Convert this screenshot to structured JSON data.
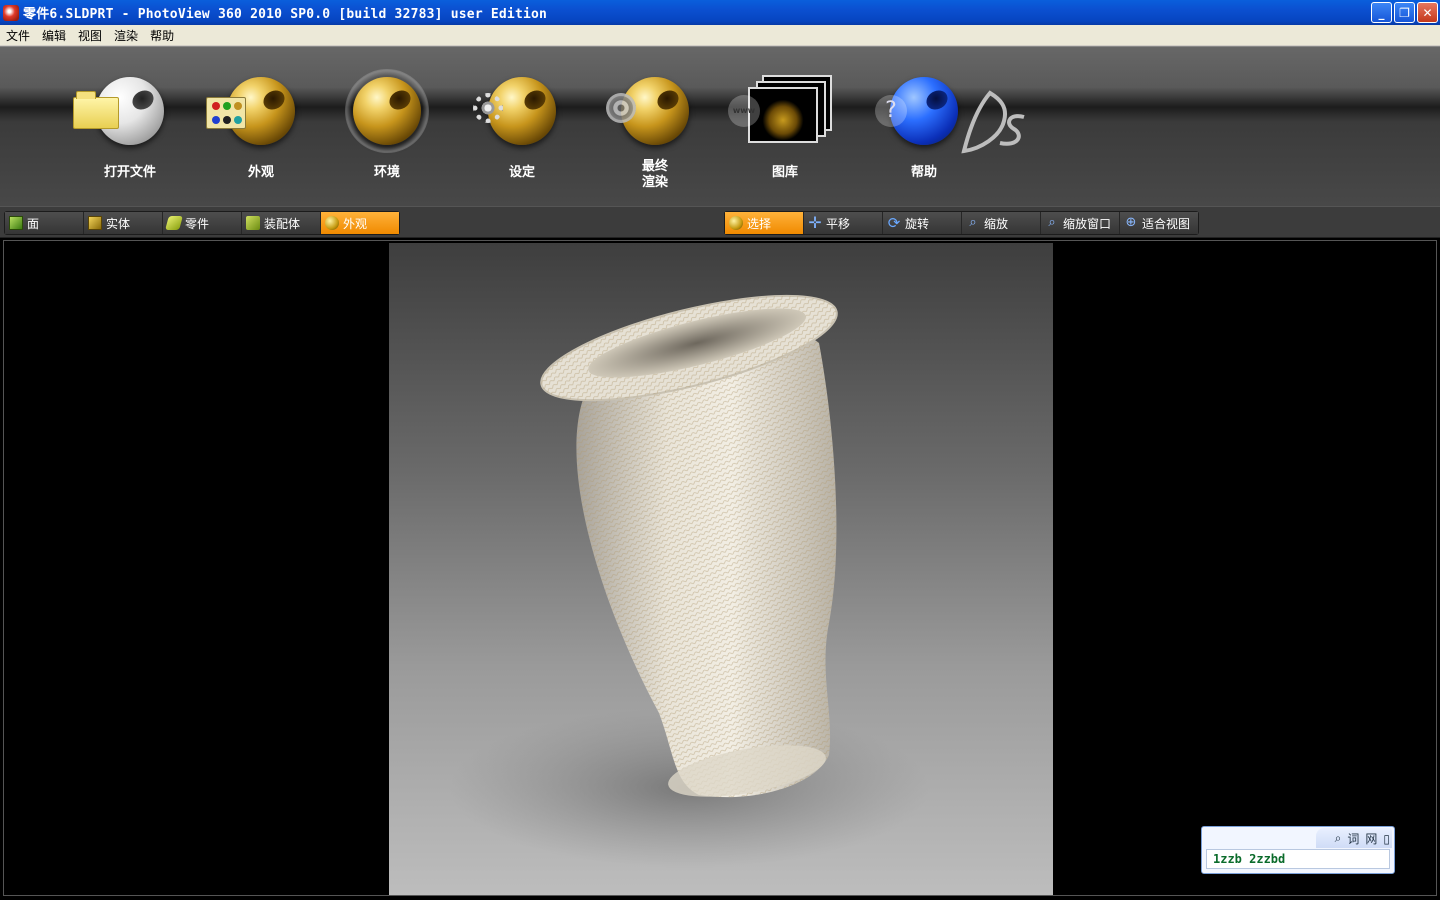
{
  "window": {
    "title": "零件6.SLDPRT - PhotoView 360 2010 SP0.0 [build 32783] user Edition",
    "buttons": {
      "minimize": "_",
      "restore": "❐",
      "close": "✕"
    }
  },
  "menu": [
    "文件",
    "编辑",
    "视图",
    "渲染",
    "帮助"
  ],
  "main_toolbar": {
    "tools": [
      {
        "label": "打开文件",
        "icon": "open-file-icon"
      },
      {
        "label": "外观",
        "icon": "appearance-icon"
      },
      {
        "label": "环境",
        "icon": "environment-icon"
      },
      {
        "label": "设定",
        "icon": "settings-icon"
      },
      {
        "label": "最终渲染",
        "label_line1": "最终",
        "label_line2": "渲染",
        "icon": "final-render-icon"
      },
      {
        "label": "图库",
        "icon": "gallery-icon"
      },
      {
        "label": "帮助",
        "icon": "help-icon"
      }
    ],
    "www_text": "www",
    "help_mark": "?"
  },
  "filter_bar": {
    "items": [
      {
        "label": "面",
        "icon": "face-icon",
        "active": false
      },
      {
        "label": "实体",
        "icon": "solid-icon",
        "active": false
      },
      {
        "label": "零件",
        "icon": "part-icon",
        "active": false
      },
      {
        "label": "装配体",
        "icon": "assembly-icon",
        "active": false
      },
      {
        "label": "外观",
        "icon": "appearance-small-icon",
        "active": true
      }
    ]
  },
  "view_bar": {
    "items": [
      {
        "label": "选择",
        "icon": "select-icon",
        "active": true
      },
      {
        "label": "平移",
        "icon": "pan-icon",
        "active": false
      },
      {
        "label": "旋转",
        "icon": "rotate-icon",
        "active": false
      },
      {
        "label": "缩放",
        "icon": "zoom-icon",
        "active": false
      },
      {
        "label": "缩放窗口",
        "icon": "zoom-window-icon",
        "active": false
      },
      {
        "label": "适合视图",
        "icon": "fit-view-icon",
        "active": false
      }
    ]
  },
  "dictionary_widget": {
    "tabs": [
      "词",
      "网"
    ],
    "text": "1zzb 2zzbd"
  },
  "colors": {
    "title_bar": "#0b4fd0",
    "active_segment": "#f08a00",
    "toolbar_bg": "#3c3c3c"
  }
}
